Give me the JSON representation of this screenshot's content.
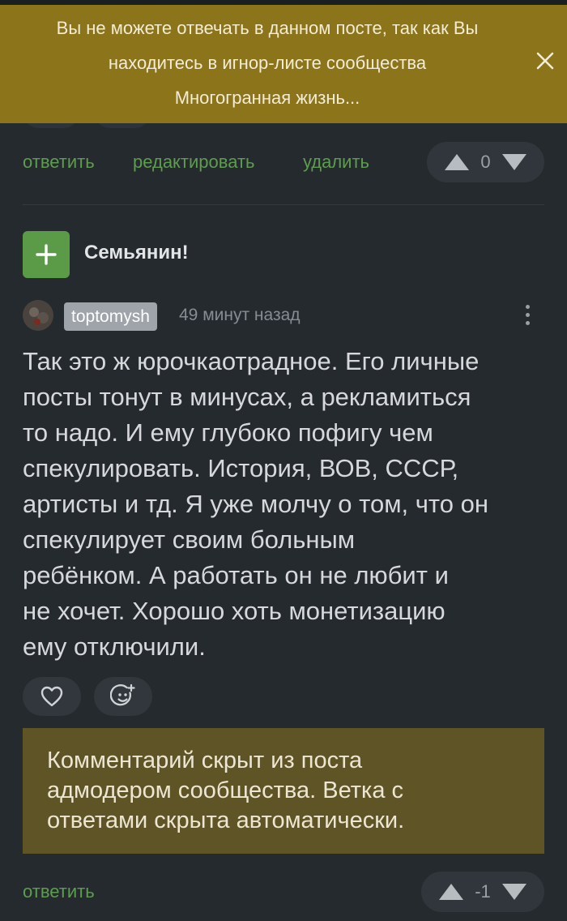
{
  "banner": {
    "line1": "Вы не можете отвечать в данном посте, так как Вы",
    "line2": "находитесь в игнор-листе сообщества",
    "line3": "Многогранная жизнь..."
  },
  "prev_comment": {
    "actions": {
      "reply": "ответить",
      "edit": "редактировать",
      "delete": "удалить"
    },
    "rating": "0"
  },
  "comment": {
    "title": "Семьянин!",
    "username": "toptomysh",
    "time": "49 минут назад",
    "lines": [
      "Так это ж юрочкаотрадное. Его личные",
      "посты тонут в минусах, а рекламиться",
      "то надо. И ему глубоко пофигу чем",
      "спекулировать. История, ВОВ, СССР,",
      "артисты и тд. Я уже молчу о том, что он",
      "спекулирует своим больным",
      "ребёнком. А работать он не любит и",
      "не хочет. Хорошо хоть монетизацию",
      "ему отключили."
    ],
    "hidden_notice": {
      "line1": "Комментарий скрыт из поста",
      "line2": "адмодером сообщества. Ветка с",
      "line3": "ответами скрыта автоматически."
    },
    "reply": "ответить",
    "rating": "-1"
  },
  "icons": {
    "close": "close-icon",
    "up": "arrow-up-icon",
    "down": "arrow-down-icon",
    "plus": "plus-icon",
    "more": "more-vertical-icon",
    "like": "heart-icon",
    "react": "emoji-add-icon"
  },
  "colors": {
    "banner_bg": "#8b741a",
    "accent_green": "#5b9a47",
    "hidden_bg": "#5f5425",
    "page_bg": "#252a2e"
  }
}
